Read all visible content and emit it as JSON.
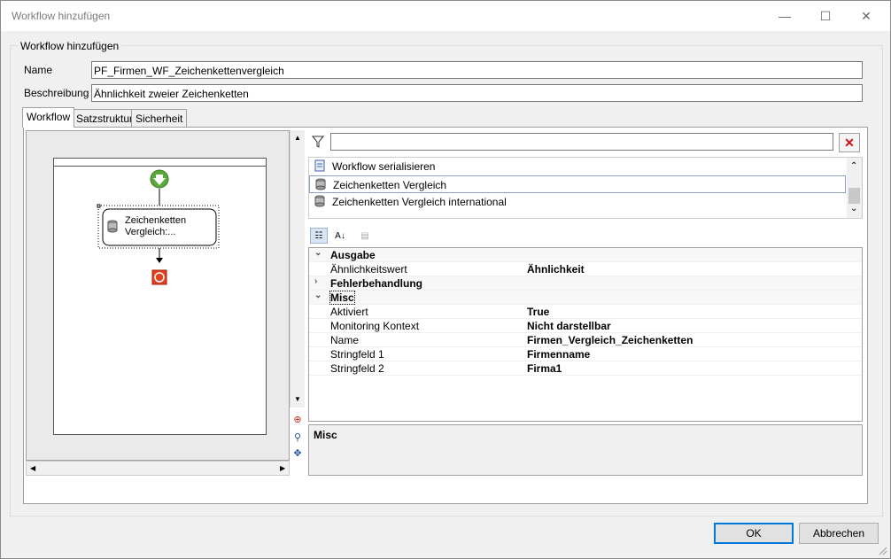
{
  "window": {
    "title": "Workflow hinzufügen",
    "minimize_glyph": "—",
    "maximize_glyph": "☐",
    "close_glyph": "✕"
  },
  "group": {
    "legend": "Workflow hinzufügen"
  },
  "form": {
    "name_label": "Name",
    "name_value": "PF_Firmen_WF_Zeichenkettenvergleich",
    "description_label": "Beschreibung",
    "description_value": "Ähnlichkeit zweier Zeichenketten"
  },
  "tabs": [
    {
      "label": "Workflow",
      "active": true
    },
    {
      "label": "Satzstruktur",
      "active": false
    },
    {
      "label": "Sicherheit",
      "active": false
    }
  ],
  "designer": {
    "activity_label_line1": "Zeichenketten",
    "activity_label_line2": "Vergleich:...",
    "start_icon": "start-arrow-icon",
    "end_icon": "stop-icon"
  },
  "activities": {
    "filter_placeholder": "",
    "items": [
      {
        "label": "Workflow serialisieren",
        "icon": "document-icon",
        "selected": false
      },
      {
        "label": "Zeichenketten Vergleich",
        "icon": "database-icon",
        "selected": true
      },
      {
        "label": "Zeichenketten Vergleich international",
        "icon": "database-icon",
        "selected": false
      }
    ]
  },
  "properties": {
    "categories": [
      {
        "name": "Ausgabe",
        "expanded": true,
        "rows": [
          {
            "name": "Ähnlichkeitswert",
            "value": "Ähnlichkeit"
          }
        ]
      },
      {
        "name": "Fehlerbehandlung",
        "expanded": false,
        "rows": []
      },
      {
        "name": "Misc",
        "expanded": true,
        "rows": [
          {
            "name": "Aktiviert",
            "value": "True"
          },
          {
            "name": "Monitoring Kontext",
            "value": "Nicht darstellbar"
          },
          {
            "name": "Name",
            "value": "Firmen_Vergleich_Zeichenketten"
          },
          {
            "name": "Stringfeld 1",
            "value": "Firmenname"
          },
          {
            "name": "Stringfeld 2",
            "value": "Firma1"
          }
        ]
      }
    ],
    "description": "Misc"
  },
  "buttons": {
    "ok": "OK",
    "cancel": "Abbrechen"
  }
}
